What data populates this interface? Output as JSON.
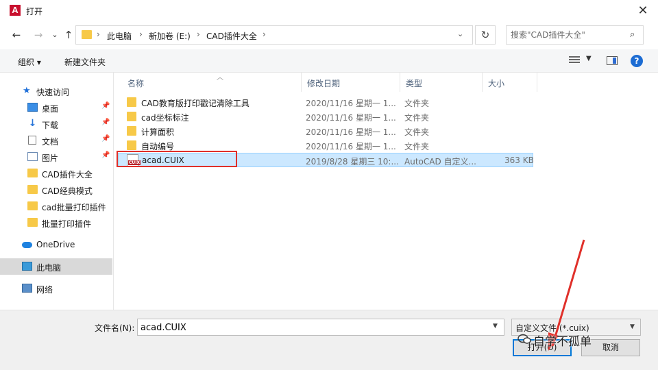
{
  "window": {
    "title": "打开",
    "app_icon_letter": "A",
    "close_glyph": "✕"
  },
  "navigation": {
    "back_glyph": "←",
    "forward_glyph": "→",
    "recent_glyph": "⌄",
    "up_glyph": "↑",
    "breadcrumb": [
      "此电脑",
      "新加卷 (E:)",
      "CAD插件大全"
    ],
    "separator": "›",
    "refresh_glyph": "↻",
    "search_placeholder": "搜索\"CAD插件大全\"",
    "search_glyph": "⌕"
  },
  "toolbar": {
    "organize_label": "组织 ▾",
    "new_folder_label": "新建文件夹"
  },
  "sidebar": {
    "items": [
      {
        "label": "快速访问",
        "icon": "star-icon"
      },
      {
        "label": "桌面",
        "icon": "desktop-icon",
        "pinned": true
      },
      {
        "label": "下载",
        "icon": "download-icon",
        "pinned": true
      },
      {
        "label": "文档",
        "icon": "document-icon",
        "pinned": true
      },
      {
        "label": "图片",
        "icon": "pictures-icon",
        "pinned": true
      },
      {
        "label": "CAD插件大全",
        "icon": "folder-icon"
      },
      {
        "label": "CAD经典模式",
        "icon": "folder-icon"
      },
      {
        "label": "cad批量打印插件",
        "icon": "folder-icon"
      },
      {
        "label": "批量打印插件",
        "icon": "folder-icon"
      },
      {
        "label": "OneDrive",
        "icon": "cloud-icon"
      },
      {
        "label": "此电脑",
        "icon": "computer-icon",
        "selected": true
      },
      {
        "label": "网络",
        "icon": "network-icon"
      }
    ]
  },
  "file_list": {
    "columns": [
      "名称",
      "修改日期",
      "类型",
      "大小"
    ],
    "rows": [
      {
        "name": "CAD教育版打印戳记清除工具",
        "date": "2020/11/16 星期一 1...",
        "type": "文件夹",
        "size": ""
      },
      {
        "name": "cad坐标标注",
        "date": "2020/11/16 星期一 1...",
        "type": "文件夹",
        "size": ""
      },
      {
        "name": "计算面积",
        "date": "2020/11/16 星期一 1...",
        "type": "文件夹",
        "size": ""
      },
      {
        "name": "自动编号",
        "date": "2020/11/16 星期一 1...",
        "type": "文件夹",
        "size": ""
      },
      {
        "name": "acad.CUIX",
        "date": "2019/8/28 星期三 10:...",
        "type": "AutoCAD 自定义...",
        "size": "363 KB",
        "selected": true
      }
    ],
    "cuix_icon_text": "CUIX"
  },
  "footer": {
    "filename_label": "文件名(N):",
    "filename_value": "acad.CUIX",
    "filetype_value": "自定义文件 (*.cuix)",
    "open_label": "打开(O)",
    "cancel_label": "取消"
  },
  "watermark": "自学不孤单",
  "colors": {
    "accent": "#0078d7",
    "highlight": "#e0302a",
    "selection": "#cce8ff",
    "folder": "#f7c948"
  }
}
